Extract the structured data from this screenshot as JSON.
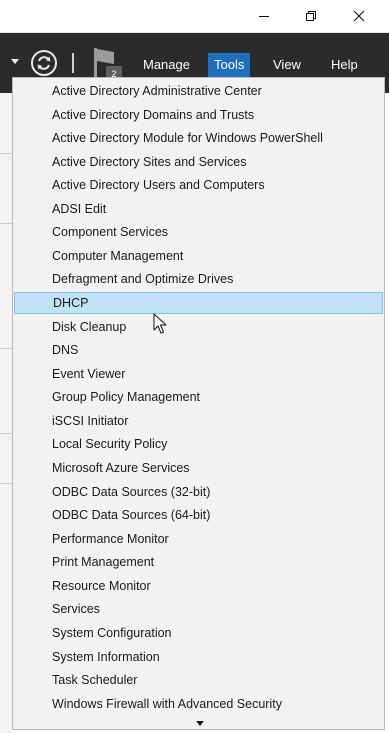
{
  "window": {
    "controls": [
      "minimize",
      "restore",
      "close"
    ]
  },
  "header": {
    "notification_count": "2",
    "menu": [
      {
        "label": "Manage"
      },
      {
        "label": "Tools",
        "active": true
      },
      {
        "label": "View"
      },
      {
        "label": "Help"
      }
    ]
  },
  "tools_menu": {
    "highlighted": "DHCP",
    "items": [
      "Active Directory Administrative Center",
      "Active Directory Domains and Trusts",
      "Active Directory Module for Windows PowerShell",
      "Active Directory Sites and Services",
      "Active Directory Users and Computers",
      "ADSI Edit",
      "Component Services",
      "Computer Management",
      "Defragment and Optimize Drives",
      "DHCP",
      "Disk Cleanup",
      "DNS",
      "Event Viewer",
      "Group Policy Management",
      "iSCSI Initiator",
      "Local Security Policy",
      "Microsoft Azure Services",
      "ODBC Data Sources (32-bit)",
      "ODBC Data Sources (64-bit)",
      "Performance Monitor",
      "Print Management",
      "Resource Monitor",
      "Services",
      "System Configuration",
      "System Information",
      "Task Scheduler",
      "Windows Firewall with Advanced Security"
    ]
  },
  "colors": {
    "header_bg": "#2b2b2b",
    "active_menu": "#1f6fbf",
    "highlight_bg": "#bfe2f6",
    "highlight_border": "#86c3e8",
    "dropdown_bg": "#f2f2f2"
  }
}
